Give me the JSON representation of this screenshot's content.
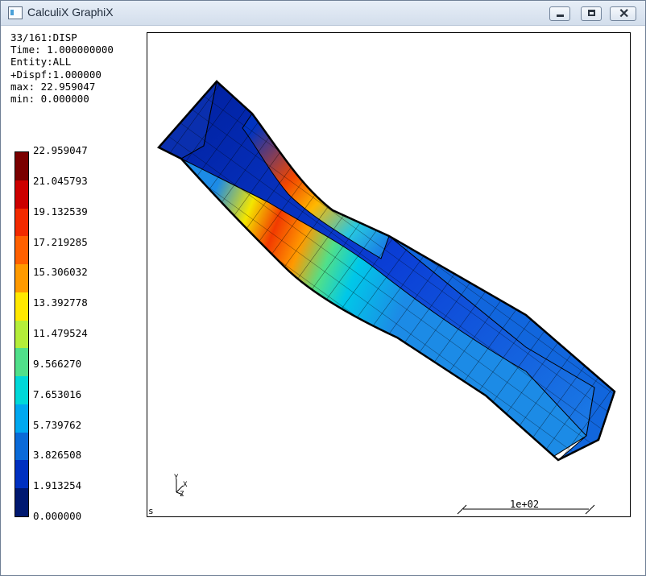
{
  "window": {
    "title": "CalculiX GraphiX"
  },
  "info": {
    "line1": "33/161:DISP",
    "line2": "Time: 1.000000000",
    "line3": "Entity:ALL",
    "line4": "+Dispf:1.000000",
    "line5": "max: 22.959047",
    "line6": "min: 0.000000"
  },
  "colorbar": {
    "labels": [
      "22.959047",
      "21.045793",
      "19.132539",
      "17.219285",
      "15.306032",
      "13.392778",
      "11.479524",
      "9.566270",
      "7.653016",
      "5.739762",
      "3.826508",
      "1.913254",
      "0.000000"
    ],
    "colors": [
      "#7a0000",
      "#cc0000",
      "#f22a00",
      "#ff6000",
      "#ff9a00",
      "#ffe800",
      "#b4ee3a",
      "#50e08a",
      "#00d8d8",
      "#00a8f0",
      "#0a6ad8",
      "#0030c0",
      "#001870"
    ]
  },
  "viewport": {
    "scale_label": "1e+02",
    "corner_mark": "s",
    "triad": {
      "y": "Y",
      "x": "X",
      "z": "Z"
    }
  }
}
